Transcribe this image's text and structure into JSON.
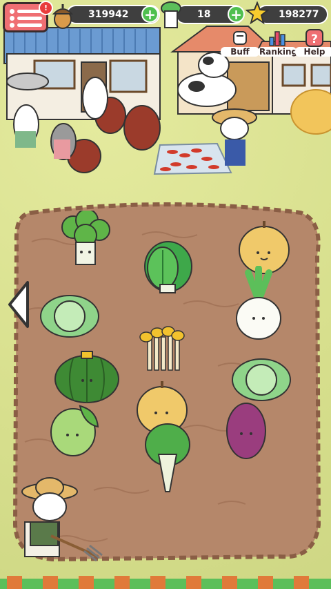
{
  "hud": {
    "menu_badge": "!",
    "acorns": "319942",
    "cabbages": "18",
    "stars": "198277",
    "buttons": {
      "buff": "Buff",
      "ranking": "Ranking",
      "help": "Help"
    }
  },
  "icons": [
    "menu-icon",
    "acorn-icon",
    "plus-icon",
    "cabbage-icon",
    "star-icon",
    "fist-icon",
    "chart-icon",
    "question-icon",
    "left-arrow-icon"
  ],
  "colors": {
    "soil": "#b5876a",
    "grass": "#d7df8d",
    "menu_red": "#ef6f73",
    "plus_green": "#4fbf4f"
  },
  "crops": [
    "broccoli",
    "lettuce",
    "pear",
    "cabbage",
    "radish",
    "enoki-mushroom",
    "pumpkin",
    "cabbage",
    "pear",
    "lime",
    "sweet-potato",
    "bok-choy"
  ]
}
